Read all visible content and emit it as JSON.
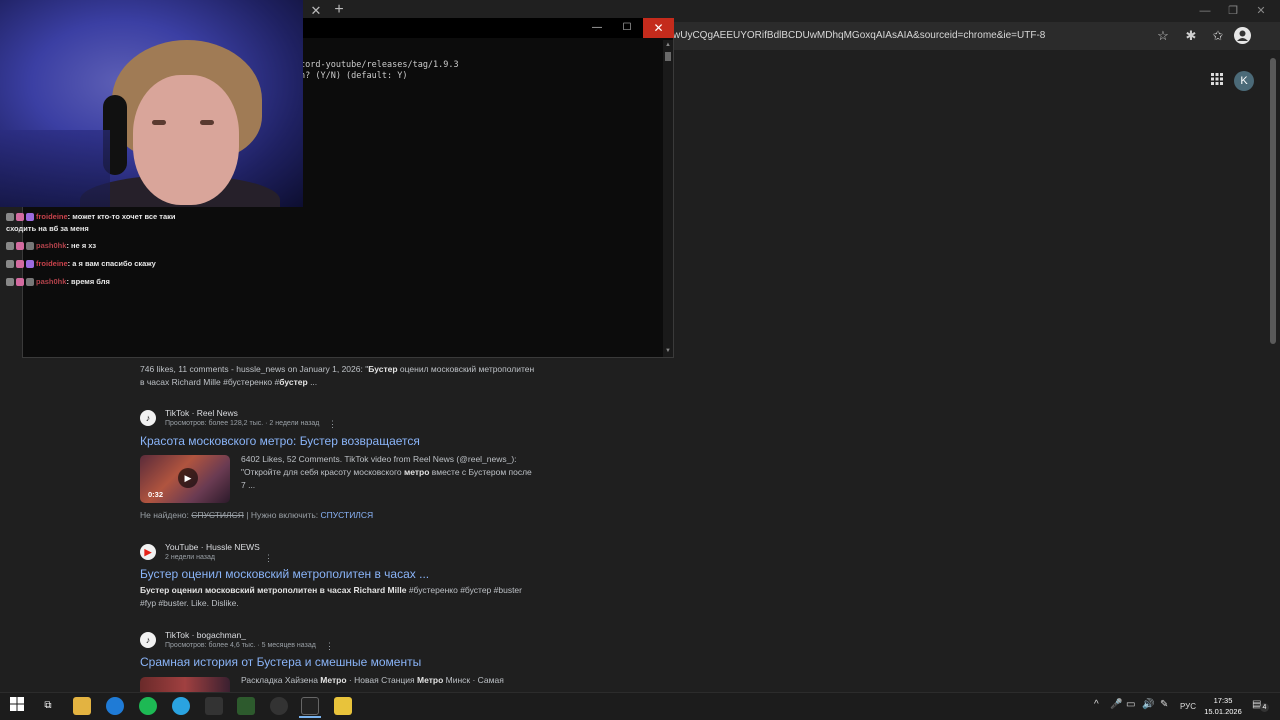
{
  "browser": {
    "url": "wUyCQgAEEUYORifBdlBCDUwMDhqMGoxqAIAsAIA&sourceid=chrome&ie=UTF-8",
    "new_tab_label": "+",
    "tab_close_label": "✕",
    "profile_initial": "",
    "account_initial": "K"
  },
  "terminal": {
    "line1": "cord-youtube/releases/tag/1.9.3",
    "line2": "n? (Y/N) (default: Y)",
    "minimize": "—",
    "maximize": "☐",
    "close": "✕"
  },
  "chat": [
    {
      "user": "froideine",
      "sep": ": ",
      "msg": "может кто-то хочет все таки",
      "msg2": "сходить на вб за меня"
    },
    {
      "user": "pash0hk",
      "sep": ": ",
      "msg": "не я хз"
    },
    {
      "user": "froideine",
      "sep": ": ",
      "msg": "а я вам спасибо скажу"
    },
    {
      "user": "pash0hk",
      "sep": ": ",
      "msg": "время бля"
    }
  ],
  "results": {
    "r0": {
      "snippet_line1_pre": "746 likes, 11 comments - hussle_news on January 1, 2026: \"",
      "snippet_line1_bold": "Бустер",
      "snippet_line1_post": " оценил московский метрополитен",
      "snippet_line2_pre": "в часах Richard Mille #бустеренко #",
      "snippet_line2_bold": "бустер",
      "snippet_line2_post": " ..."
    },
    "r1": {
      "source": "TikTok · Reel News",
      "meta": "Просмотров: более 128,2 тыс. · 2 недели назад",
      "title": "Красота московского метро: Бустер возвращается",
      "snippet_line1": "6402 Likes, 52 Comments. TikTok video from Reel News (@reel_news_):",
      "snippet_line2_pre": "\"Откройте для себя красоту московского ",
      "snippet_line2_bold": "метро",
      "snippet_line2_post": " вместе с Бустером после",
      "snippet_line3": "7 ...",
      "duration": "0:32",
      "missing_label": "Не найдено: ",
      "missing_word": "СПУСТИЛСЯ",
      "include_label": " | Нужно включить: ",
      "include_word": "СПУСТИЛСЯ"
    },
    "r2": {
      "source": "YouTube · Hussle NEWS",
      "meta": "2 недели назад",
      "title": "Бустер оценил московский метрополитен в часах ...",
      "snippet_line1_bold": "Бустер оценил московский метрополитен в часах Richard Mille",
      "snippet_line1_post": " #бустеренко #бустер #buster",
      "snippet_line2": "#fyp #buster. Like. Dislike."
    },
    "r3": {
      "source": "TikTok · bogachman_",
      "meta": "Просмотров: более 4,6 тыс. · 5 месяцев назад",
      "title": "Срамная история от Бустера и смешные моменты",
      "snippet_line1_pre": "Раскладка Хайзена ",
      "snippet_line1_bold": "Метро",
      "snippet_line1_mid": " · Новая Станция ",
      "snippet_line1_bold2": "Метро",
      "snippet_line1_post": " Минск · Самая"
    }
  },
  "taskbar": {
    "lang": "РУС",
    "time": "17:35",
    "date": "15.01.2026",
    "notif_count": "4"
  },
  "colors": {
    "accent_link": "#8ab4f8",
    "terminal_close": "#c42b1c",
    "chat_name": "#c8424b"
  }
}
